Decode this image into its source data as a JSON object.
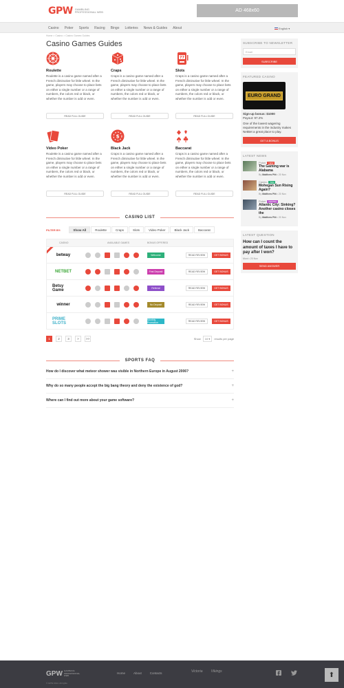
{
  "brand": {
    "mark": "GPW",
    "tagline": "Gambling Professional Web"
  },
  "ad": {
    "text": "AD 468x60"
  },
  "nav": {
    "items": [
      "Casino",
      "Poker",
      "Sports",
      "Racing",
      "Bingo",
      "Lotteries",
      "News & Guides",
      "About"
    ],
    "lang": "English"
  },
  "breadcrumb": "Home  >  Casino  >  Casino Games Guides",
  "page_title": "Casino Games Guides",
  "games": [
    {
      "title": "Roulette",
      "icon": "roulette-wheel-icon",
      "desc": "Roulette is a casino game named after a French diminutive for little wheel. In the game, players may choose to place bets on either a single number or a range of numbers, the colors red or black, or whether the number is odd or even.",
      "btn": "Read full guide"
    },
    {
      "title": "Craps",
      "icon": "dice-icon",
      "desc": "Craps is a casino game named after a French diminutive for little wheel. In the game, players may choose to place bets on either a single number or a range of numbers, the colors red or black, or whether the number is odd or even.",
      "btn": "Read full guide"
    },
    {
      "title": "Slots",
      "icon": "slot-machine-icon",
      "desc": "Craps is a casino game named after a French diminutive for little wheel. In the game, players may choose to place bets on either a single number or a range of numbers, the colors red or black, or whether the number is odd or even.",
      "btn": "Read full guide"
    },
    {
      "title": "Video Poker",
      "icon": "playing-cards-icon",
      "desc": "Roulette is a casino game named after a French diminutive for little wheel. In the game, players may choose to place bets on either a single number or a range of numbers, the colors red or black, or whether the number is odd or even.",
      "btn": "Read full guide"
    },
    {
      "title": "Black Jack",
      "icon": "poker-chip-icon",
      "desc": "Craps is a casino game named after a French diminutive for little wheel. In the game, players may choose to place bets on either a single number or a range of numbers, the colors red or black, or whether the number is odd or even.",
      "btn": "Read full guide"
    },
    {
      "title": "Baccarat",
      "icon": "card-suits-icon",
      "desc": "Craps is a casino game named after a French diminutive for little wheel. In the game, players may choose to place bets on either a single number or a range of numbers, the colors red or black, or whether the number is odd or even.",
      "btn": "Read full guide"
    }
  ],
  "casino_list": {
    "title": "CASINO LIST",
    "filter_label": "FILTER BY:",
    "filters": [
      "Show All",
      "Roulette",
      "Craps",
      "Slots",
      "Video Poker",
      "Black Jack",
      "Baccarat"
    ],
    "headers": {
      "casino": "Casino",
      "games": "Available games",
      "bonus": "Bonus offered"
    },
    "rows": [
      {
        "brand": "betway",
        "brand_color": "#111111",
        "bonus": "Welcome",
        "bonus_color": "#2db07a",
        "review": "Read review",
        "get": "Get bonus",
        "ribbon": true
      },
      {
        "brand": "NETBET",
        "brand_color": "#3aa635",
        "bonus": "First Deposit",
        "bonus_color": "#cc3fae",
        "review": "Read review",
        "get": "Get bonus",
        "ribbon": false
      },
      {
        "brand": "Betsy Game",
        "brand_color": "#222222",
        "bonus": "Referral",
        "bonus_color": "#8e4fc9",
        "review": "Read review",
        "get": "Get bonus",
        "ribbon": false
      },
      {
        "brand": "winner",
        "brand_color": "#111111",
        "bonus": "No Deposit",
        "bonus_color": "#a48a2c",
        "review": "Read review",
        "get": "Get bonus",
        "ribbon": false
      },
      {
        "brand": "PRIME SLOTS",
        "brand_color": "#3db0c8",
        "bonus": "Monthly Promotion",
        "bonus_color": "#2db8c8",
        "review": "Read review",
        "get": "Get bonus",
        "ribbon": false
      }
    ],
    "pages": [
      "1",
      "2",
      "3",
      ">",
      ">>"
    ],
    "show_label": "Show",
    "per_page": "10",
    "per_page_suffix": "results per page"
  },
  "faq": {
    "title": "SPORTS FAQ",
    "items": [
      "How do I discover what meteor shower was visible in Northern Europe in August 2006?",
      "Why do so many people accept the big bang theory and deny the existence of god?",
      "Where can I find out more about your game software?"
    ]
  },
  "sidebar": {
    "newsletter": {
      "title": "Subscribe to newsletter",
      "placeholder": "Email",
      "button": "Subscribe"
    },
    "featured": {
      "title": "Featured casino",
      "logo": "EURO GRAND",
      "signup": "Sign-up bonus: $1000",
      "payout": "Payout: 97.2%",
      "text": "One of the lowest wagering requirements in the industry makes NetBet a great place to play.",
      "button": "Get a bonus"
    },
    "news": {
      "title": "Latest news",
      "items": [
        {
          "cat": "Poker",
          "tag": "NEW",
          "tag_color": "#e8483b",
          "title": "The Gaming war is Alabama",
          "author": "Matthew Pitt",
          "date": "20 Nov"
        },
        {
          "cat": "Casino",
          "tag": "TAG",
          "tag_color": "#2db07a",
          "title": "Mohegan Sun Rising Again?",
          "author": "Matthew Pitt",
          "date": "20 Nov"
        },
        {
          "cat": "Poker",
          "tag": "PROMO",
          "tag_color": "#b84fc9",
          "title": "Atlantic City: Sinking? Another casino closes the",
          "author": "Matthew Pitt",
          "date": "20 Nov"
        }
      ]
    },
    "question": {
      "title": "Latest question",
      "text": "How can I count the amount of taxes I have to pay after I won?",
      "meta": "Moni • 20 Nov",
      "button": "Send answer"
    }
  },
  "footer": {
    "mark": "GPW",
    "tagline": "Gambling Professional Web",
    "copy": "© GPW 2014. All rights",
    "links": [
      "Home",
      "About",
      "Contacts"
    ],
    "partners": [
      "Victoria",
      "Vikings"
    ]
  },
  "colors": {
    "accent": "#e8483b",
    "footer": "#3c3c42"
  }
}
